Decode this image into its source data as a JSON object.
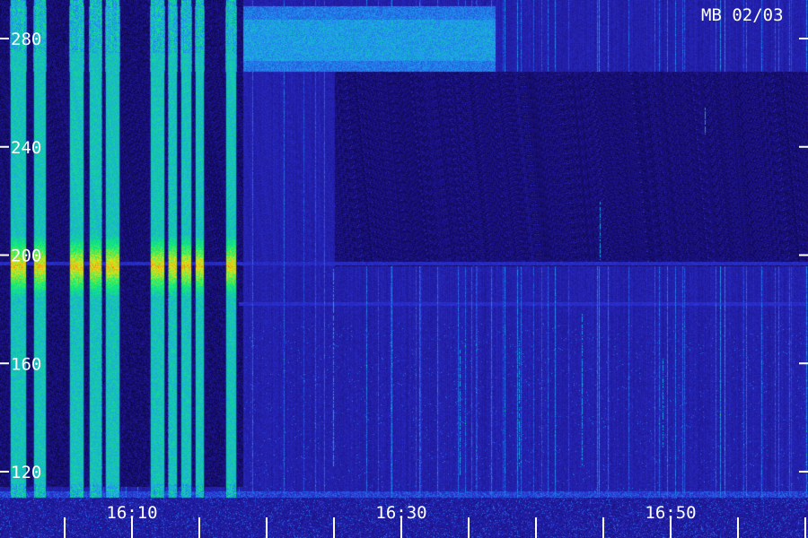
{
  "chart_data": {
    "type": "heatmap",
    "title": "MB 02/03",
    "xlabel": "",
    "ylabel": "",
    "x_ticks": [
      "16:10",
      "16:30",
      "16:50"
    ],
    "x_range_minutes_after_16": [
      0,
      60
    ],
    "y_ticks": [
      120,
      160,
      200,
      240,
      280
    ],
    "y_range": [
      110,
      290
    ],
    "grid": false,
    "legend": "none",
    "colormap": [
      "#000010",
      "#1a1080",
      "#2a2fd0",
      "#1e9df0",
      "#10f070",
      "#f0e010",
      "#f01010"
    ],
    "features": [
      {
        "kind": "bright-vertical-bands",
        "time_start": "16:00",
        "time_end": "16:17",
        "level": "high"
      },
      {
        "kind": "horizontal-band",
        "freq_low": 268,
        "freq_high": 292,
        "time_start": "16:00",
        "time_end": "16:37",
        "level": "medium"
      },
      {
        "kind": "horizontal-line",
        "freq": 182,
        "time_start": "16:17",
        "time_end": "16:60",
        "level": "low"
      },
      {
        "kind": "horizontal-line",
        "freq": 197,
        "time_start": "16:00",
        "time_end": "16:60",
        "level": "low"
      },
      {
        "kind": "quiet-region",
        "freq_low": 195,
        "freq_high": 268,
        "time_start": "16:25",
        "time_end": "16:60",
        "level": "very-low"
      }
    ]
  }
}
